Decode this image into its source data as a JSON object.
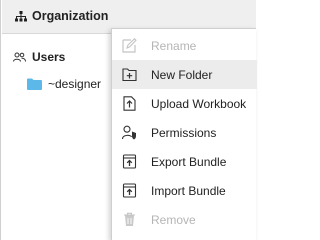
{
  "header": {
    "title": "Organization",
    "icon": "org-tree-icon"
  },
  "tree": {
    "users_label": "Users",
    "users_icon": "users-icon",
    "folder_label": "~designer",
    "folder_icon": "folder-icon",
    "folder_color": "#5bb8e8"
  },
  "context_menu": {
    "items": [
      {
        "label": "Rename",
        "icon": "rename-icon",
        "disabled": true
      },
      {
        "label": "New Folder",
        "icon": "new-folder-icon",
        "hover": true
      },
      {
        "label": "Upload Workbook",
        "icon": "upload-workbook-icon"
      },
      {
        "label": "Permissions",
        "icon": "permissions-icon"
      },
      {
        "label": "Export Bundle",
        "icon": "export-bundle-icon"
      },
      {
        "label": "Import Bundle",
        "icon": "import-bundle-icon"
      },
      {
        "label": "Remove",
        "icon": "remove-icon",
        "disabled": true
      }
    ]
  },
  "colors": {
    "disabled_text": "#b5b5b5",
    "hover_bg": "#ececec",
    "icon_dark": "#333333"
  }
}
